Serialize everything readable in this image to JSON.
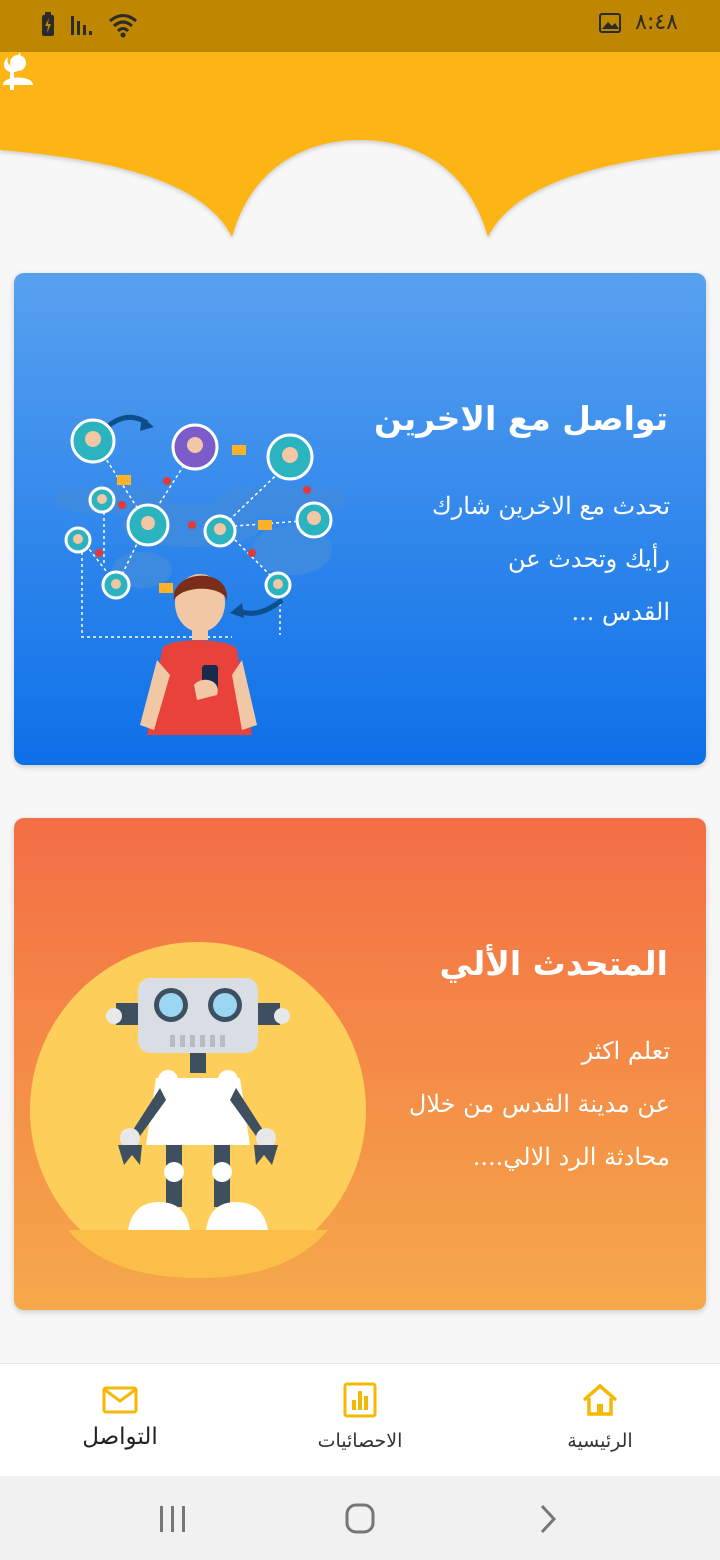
{
  "status_bar": {
    "time": "٨:٤٨",
    "icons": [
      "battery-charging-icon",
      "signal-icon",
      "wifi-icon",
      "gallery-icon"
    ]
  },
  "header": {
    "icons": [
      "crescent-icon",
      "user-profile-icon"
    ],
    "colors": {
      "primary": "#fdb515"
    }
  },
  "cards": [
    {
      "title": "تواصل مع الاخرين",
      "desc_lines": [
        "تحدث مع الاخرين شارك",
        "رأيك وتحدث عن",
        "القدس ..."
      ],
      "illustration": "network-people-illustration",
      "gradient": [
        "#58a1ef",
        "#0d70e8"
      ]
    },
    {
      "title": "المتحدث الألي",
      "desc_lines": [
        "تعلم اكثر",
        "عن مدينة القدس من خلال",
        "محادثة الرد الالي...."
      ],
      "illustration": "robot-illustration",
      "gradient": [
        "#f36e45",
        "#f5a94a"
      ]
    }
  ],
  "bottom_nav": {
    "items": [
      {
        "label": "التواصل",
        "icon": "mail-icon",
        "active": true
      },
      {
        "label": "الاحصائيات",
        "icon": "chart-icon",
        "active": false
      },
      {
        "label": "الرئيسية",
        "icon": "home-icon",
        "active": false
      }
    ],
    "icon_color": "#f5b800"
  },
  "system_nav": {
    "icons": [
      "recents-icon",
      "home-circle-icon",
      "back-icon"
    ]
  }
}
